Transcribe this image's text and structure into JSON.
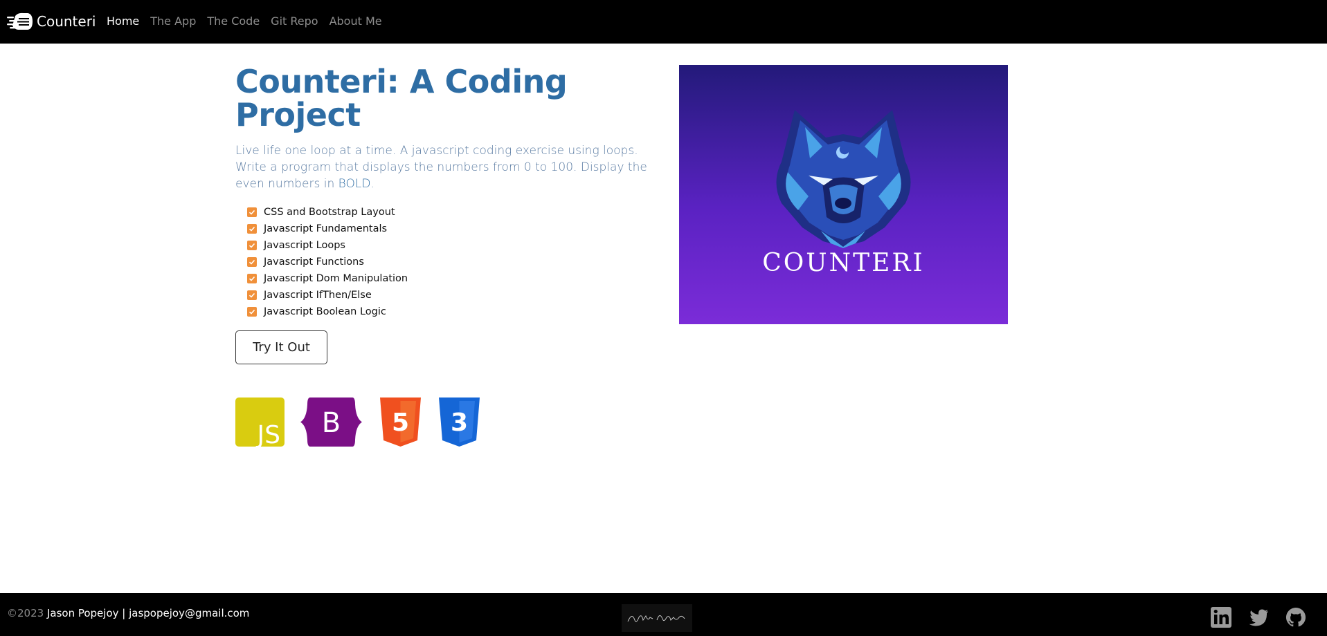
{
  "navbar": {
    "brand": "Counteri",
    "links": [
      "Home",
      "The App",
      "The Code",
      "Git Repo",
      "About Me"
    ],
    "active_index": 0
  },
  "main": {
    "title": "Counteri: A Coding Project",
    "lead_text": "Live life one loop at a time. A javascript coding exercise using loops. Write a program that displays the numbers from 0 to 100. Display the even numbers in ",
    "lead_bold": "BOLD",
    "lead_end": ".",
    "features": [
      "CSS and Bootstrap Layout",
      "Javascript Fundamentals",
      "Javascript Loops",
      "Javascript Functions",
      "Javascript Dom Manipulation",
      "Javascript IfThen/Else",
      "Javascript Boolean Logic"
    ],
    "try_button": "Try It Out",
    "tech_icons": [
      "javascript-icon",
      "bootstrap-icon",
      "html5-icon",
      "css3-icon"
    ],
    "tech_labels": {
      "js": "JS",
      "bootstrap": "B",
      "html5": "5",
      "css3": "3"
    }
  },
  "hero": {
    "logo_text": "COUNTERI",
    "icon": "wolf-icon"
  },
  "footer": {
    "copyright": "©2023",
    "author": "Jason Popejoy | jaspopejoy@gmail.com",
    "signature": "Jason Popejoy",
    "social": [
      "linkedin-icon",
      "twitter-icon",
      "github-icon"
    ]
  },
  "colors": {
    "title": "#2e6da4",
    "check": "#f0903a",
    "js": "#d9cc10",
    "bootstrap": "#7b0f86",
    "html5": "#f0501f",
    "css3": "#1566d6"
  }
}
